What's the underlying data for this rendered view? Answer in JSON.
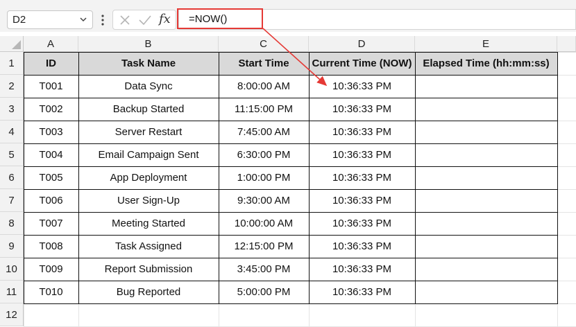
{
  "formula_bar": {
    "name_box": "D2",
    "fx_label": "fx",
    "formula": "=NOW()"
  },
  "columns": [
    "A",
    "B",
    "C",
    "D",
    "E"
  ],
  "rows": [
    "1",
    "2",
    "3",
    "4",
    "5",
    "6",
    "7",
    "8",
    "9",
    "10",
    "11",
    "12"
  ],
  "table": {
    "headers": [
      "ID",
      "Task Name",
      "Start Time",
      "Current Time (NOW)",
      "Elapsed Time (hh:mm:ss)"
    ],
    "data": [
      [
        "T001",
        "Data Sync",
        "8:00:00 AM",
        "10:36:33 PM",
        ""
      ],
      [
        "T002",
        "Backup Started",
        "11:15:00 PM",
        "10:36:33 PM",
        ""
      ],
      [
        "T003",
        "Server Restart",
        "7:45:00 AM",
        "10:36:33 PM",
        ""
      ],
      [
        "T004",
        "Email Campaign Sent",
        "6:30:00 PM",
        "10:36:33 PM",
        ""
      ],
      [
        "T005",
        "App Deployment",
        "1:00:00 PM",
        "10:36:33 PM",
        ""
      ],
      [
        "T006",
        "User Sign-Up",
        "9:30:00 AM",
        "10:36:33 PM",
        ""
      ],
      [
        "T007",
        "Meeting Started",
        "10:00:00 AM",
        "10:36:33 PM",
        ""
      ],
      [
        "T008",
        "Task Assigned",
        "12:15:00 PM",
        "10:36:33 PM",
        ""
      ],
      [
        "T009",
        "Report Submission",
        "3:45:00 PM",
        "10:36:33 PM",
        ""
      ],
      [
        "T010",
        "Bug Reported",
        "5:00:00 PM",
        "10:36:33 PM",
        ""
      ]
    ]
  },
  "colors": {
    "highlight": "#e53935",
    "header_fill": "#d9d9d9",
    "chrome": "#f2f2f2"
  }
}
